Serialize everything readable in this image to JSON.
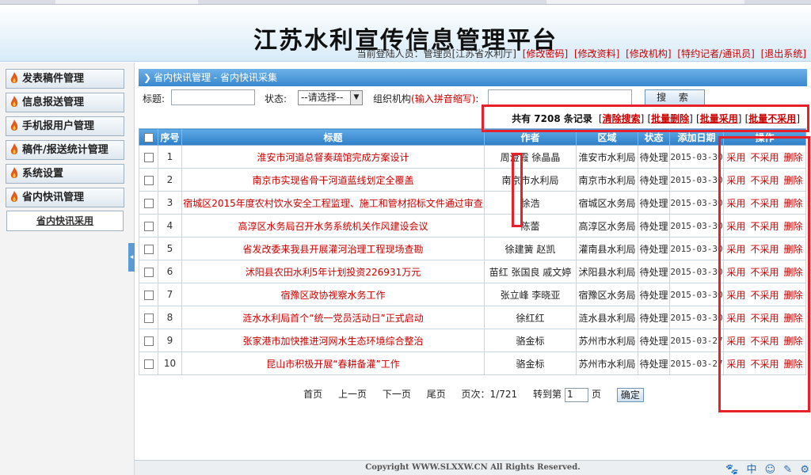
{
  "header": {
    "site_title": "江苏水利宣传信息管理平台",
    "current_user": "当前登陆人员：管理员[江苏省水利厅]",
    "links": [
      "[修改密码]",
      "[修改资料]",
      "[修改机构]",
      "[特约记者/通讯员]",
      "[退出系统]"
    ]
  },
  "sidebar": {
    "items": [
      "发表稿件管理",
      "信息报送管理",
      "手机报用户管理",
      "稿件/报送统计管理",
      "系统设置",
      "省内快讯管理"
    ],
    "sub_item": "省内快讯采用"
  },
  "breadcrumb": "省内快讯管理 - 省内快讯采集",
  "filters": {
    "title_label": "标题:",
    "status_label": "状态:",
    "status_value": "--请选择--",
    "org_label": "组织机构",
    "org_hint": "(输入拼音缩写)",
    "org_colon": ":",
    "search_button": "搜 索"
  },
  "summary": {
    "count_text": "共有 7208 条记录",
    "clear_search": "清除搜索",
    "batch_delete": "批量删除",
    "batch_adopt": "批量采用",
    "batch_reject": "批量不采用"
  },
  "table": {
    "headers": [
      "序号",
      "标题",
      "作者",
      "区域",
      "状态",
      "添加日期",
      "操作"
    ],
    "rows": [
      {
        "no": "1",
        "title": "淮安市河道总督奏疏馆完成方案设计",
        "author": "周澄霞 徐晶晶",
        "region": "淮安市水利局",
        "status": "待处理",
        "date": "2015-03-30"
      },
      {
        "no": "2",
        "title": "南京市实现省骨干河道蓝线划定全覆盖",
        "author": "南京市水利局",
        "region": "南京市水利局",
        "status": "待处理",
        "date": "2015-03-30"
      },
      {
        "no": "3",
        "title": "宿城区2015年度农村饮水安全工程监理、施工和管材招标文件通过审查",
        "author": "徐浩",
        "region": "宿城区水务局",
        "status": "待处理",
        "date": "2015-03-30"
      },
      {
        "no": "4",
        "title": "高淳区水务局召开水务系统机关作风建设会议",
        "author": "陈蕾",
        "region": "高淳区水务局",
        "status": "待处理",
        "date": "2015-03-30"
      },
      {
        "no": "5",
        "title": "省发改委来我县开展灌河治理工程现场查勘",
        "author": "徐建簧 赵凯",
        "region": "灌南县水利局",
        "status": "待处理",
        "date": "2015-03-30"
      },
      {
        "no": "6",
        "title": "沭阳县农田水利5年计划投资226931万元",
        "author": "苗红 张国良 戚文婷",
        "region": "沭阳县水利局",
        "status": "待处理",
        "date": "2015-03-30"
      },
      {
        "no": "7",
        "title": "宿豫区政协视察水务工作",
        "author": "张立峰 李晓亚",
        "region": "宿豫区水务局",
        "status": "待处理",
        "date": "2015-03-30"
      },
      {
        "no": "8",
        "title": "涟水水利局首个“统一党员活动日”正式启动",
        "author": "徐红红",
        "region": "涟水县水利局",
        "status": "待处理",
        "date": "2015-03-30"
      },
      {
        "no": "9",
        "title": "张家港市加快推进河网水生态环境综合整治",
        "author": "骆金标",
        "region": "苏州市水利局",
        "status": "待处理",
        "date": "2015-03-27"
      },
      {
        "no": "10",
        "title": "昆山市积极开展“春耕备灌”工作",
        "author": "骆金标",
        "region": "苏州市水利局",
        "status": "待处理",
        "date": "2015-03-27"
      }
    ],
    "ops": [
      "采用",
      "不采用",
      "删除"
    ]
  },
  "pager": {
    "first": "首页",
    "prev": "上一页",
    "next": "下一页",
    "last": "尾页",
    "page_info": "页次：1/721",
    "goto_label": "转到第",
    "goto_value": "1",
    "page_unit": "页",
    "confirm": "确定"
  },
  "footer": "Copyright WWW.SLXXW.CN All Rights Reserved.",
  "tray_icons": [
    "paw-icon",
    "zhong-icon",
    "smile-icon",
    "pen-icon",
    "gear-icon"
  ],
  "tray_labels": [
    "🐾",
    "中",
    "☺",
    "✎",
    "⚙"
  ],
  "colors": {
    "accent": "#3a88cf",
    "link_red": "#cc0000",
    "highlight_box": "#e8202a"
  }
}
